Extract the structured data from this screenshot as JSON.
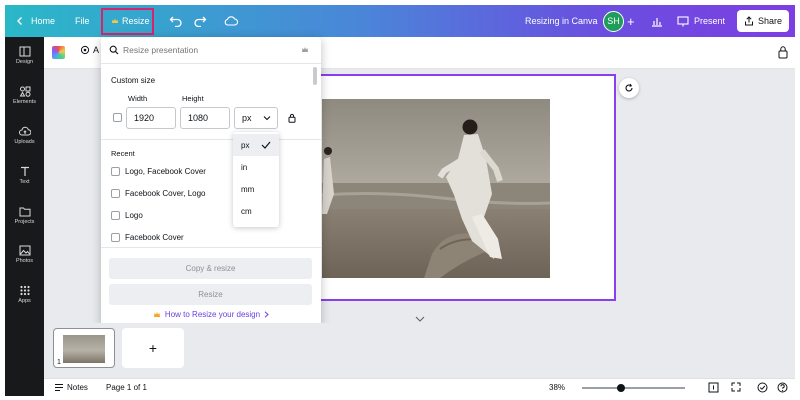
{
  "topbar": {
    "home_label": "Home",
    "file_label": "File",
    "resize_label": "Resize",
    "doc_title": "Resizing in Canva",
    "avatar_initials": "SH",
    "present_label": "Present",
    "share_label": "Share",
    "colors": {
      "gradient_start": "#2ab8c8",
      "gradient_end": "#7d3ee2",
      "resize_highlight": "#d6246d",
      "avatar_bg": "#1f9d5a"
    }
  },
  "sidebar": {
    "items": [
      {
        "label": "Design",
        "icon": "layout-icon"
      },
      {
        "label": "Elements",
        "icon": "shapes-icon"
      },
      {
        "label": "Uploads",
        "icon": "cloud-upload-icon"
      },
      {
        "label": "Text",
        "icon": "text-t-icon"
      },
      {
        "label": "Projects",
        "icon": "folder-icon"
      },
      {
        "label": "Photos",
        "icon": "image-icon"
      },
      {
        "label": "Apps",
        "icon": "apps-grid-icon"
      }
    ]
  },
  "toolbar": {
    "animate_partial": "A"
  },
  "resize_panel": {
    "search_placeholder": "Resize presentation",
    "custom_size_title": "Custom size",
    "width_label": "Width",
    "height_label": "Height",
    "width_value": "1920",
    "height_value": "1080",
    "unit_selected": "px",
    "unit_options": [
      "px",
      "in",
      "mm",
      "cm"
    ],
    "recent_title": "Recent",
    "recent_items": [
      "Logo, Facebook Cover",
      "Facebook Cover, Logo",
      "Logo",
      "Facebook Cover"
    ],
    "copy_resize_label": "Copy & resize",
    "resize_label": "Resize",
    "howto_link": "How to Resize your design"
  },
  "pages": {
    "thumb_number": "1",
    "add_page": "+"
  },
  "footer": {
    "notes_label": "Notes",
    "page_indicator": "Page 1 of 1",
    "zoom": "38%",
    "zoom_level": 0.38
  }
}
